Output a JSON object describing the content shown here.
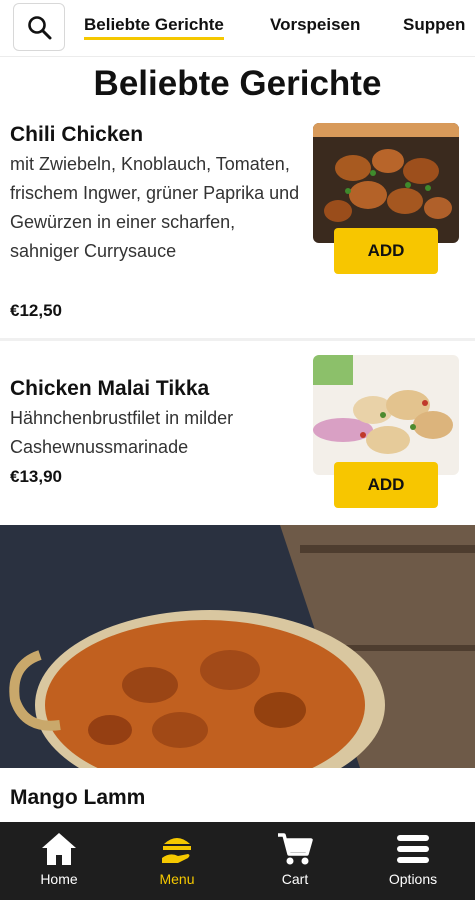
{
  "header": {
    "tabs": [
      {
        "label": "Beliebte Gerichte",
        "active": true
      },
      {
        "label": "Vorspeisen",
        "active": false
      },
      {
        "label": "Suppen",
        "active": false
      }
    ]
  },
  "section": {
    "title": "Beliebte Gerichte"
  },
  "items": [
    {
      "name": "Chili Chicken",
      "description": "mit Zwiebeln, Knoblauch, Tomaten, frischem Ingwer, grüner Paprika und Gewürzen in einer scharfen, sahniger Currysauce",
      "price": "€12,50",
      "add_label": "ADD"
    },
    {
      "name": "Chicken Malai Tikka",
      "description": "Hähnchenbrustfilet in milder Cashewnussmarinade",
      "price": "€13,90",
      "add_label": "ADD"
    },
    {
      "name": "Mango Lamm"
    }
  ],
  "bottom_nav": [
    {
      "label": "Home",
      "icon": "home-icon"
    },
    {
      "label": "Menu",
      "icon": "menu-icon",
      "active": true
    },
    {
      "label": "Cart",
      "icon": "cart-icon"
    },
    {
      "label": "Options",
      "icon": "options-icon"
    }
  ],
  "colors": {
    "accent": "#f7c600",
    "nav_bg": "#1e1e1e"
  }
}
